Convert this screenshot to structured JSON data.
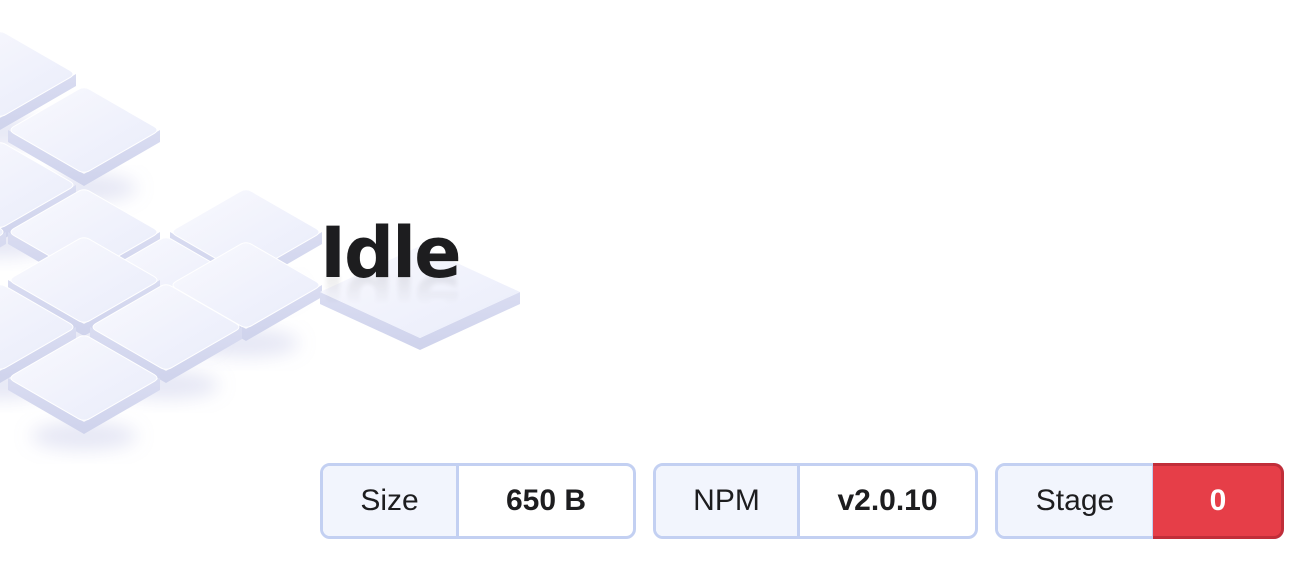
{
  "title": "Idle",
  "badges": {
    "size": {
      "label": "Size",
      "value": "650 B"
    },
    "npm": {
      "label": "NPM",
      "value": "v2.0.10"
    },
    "stage": {
      "label": "Stage",
      "value": "0"
    }
  },
  "colors": {
    "stage_value_bg": "#e63e48",
    "badge_border": "#c3d0f2",
    "badge_label_bg": "#f2f5fd",
    "text": "#1d1d1f",
    "tile_top": "#eef0fb",
    "tile_side": "#d3d6ee"
  }
}
